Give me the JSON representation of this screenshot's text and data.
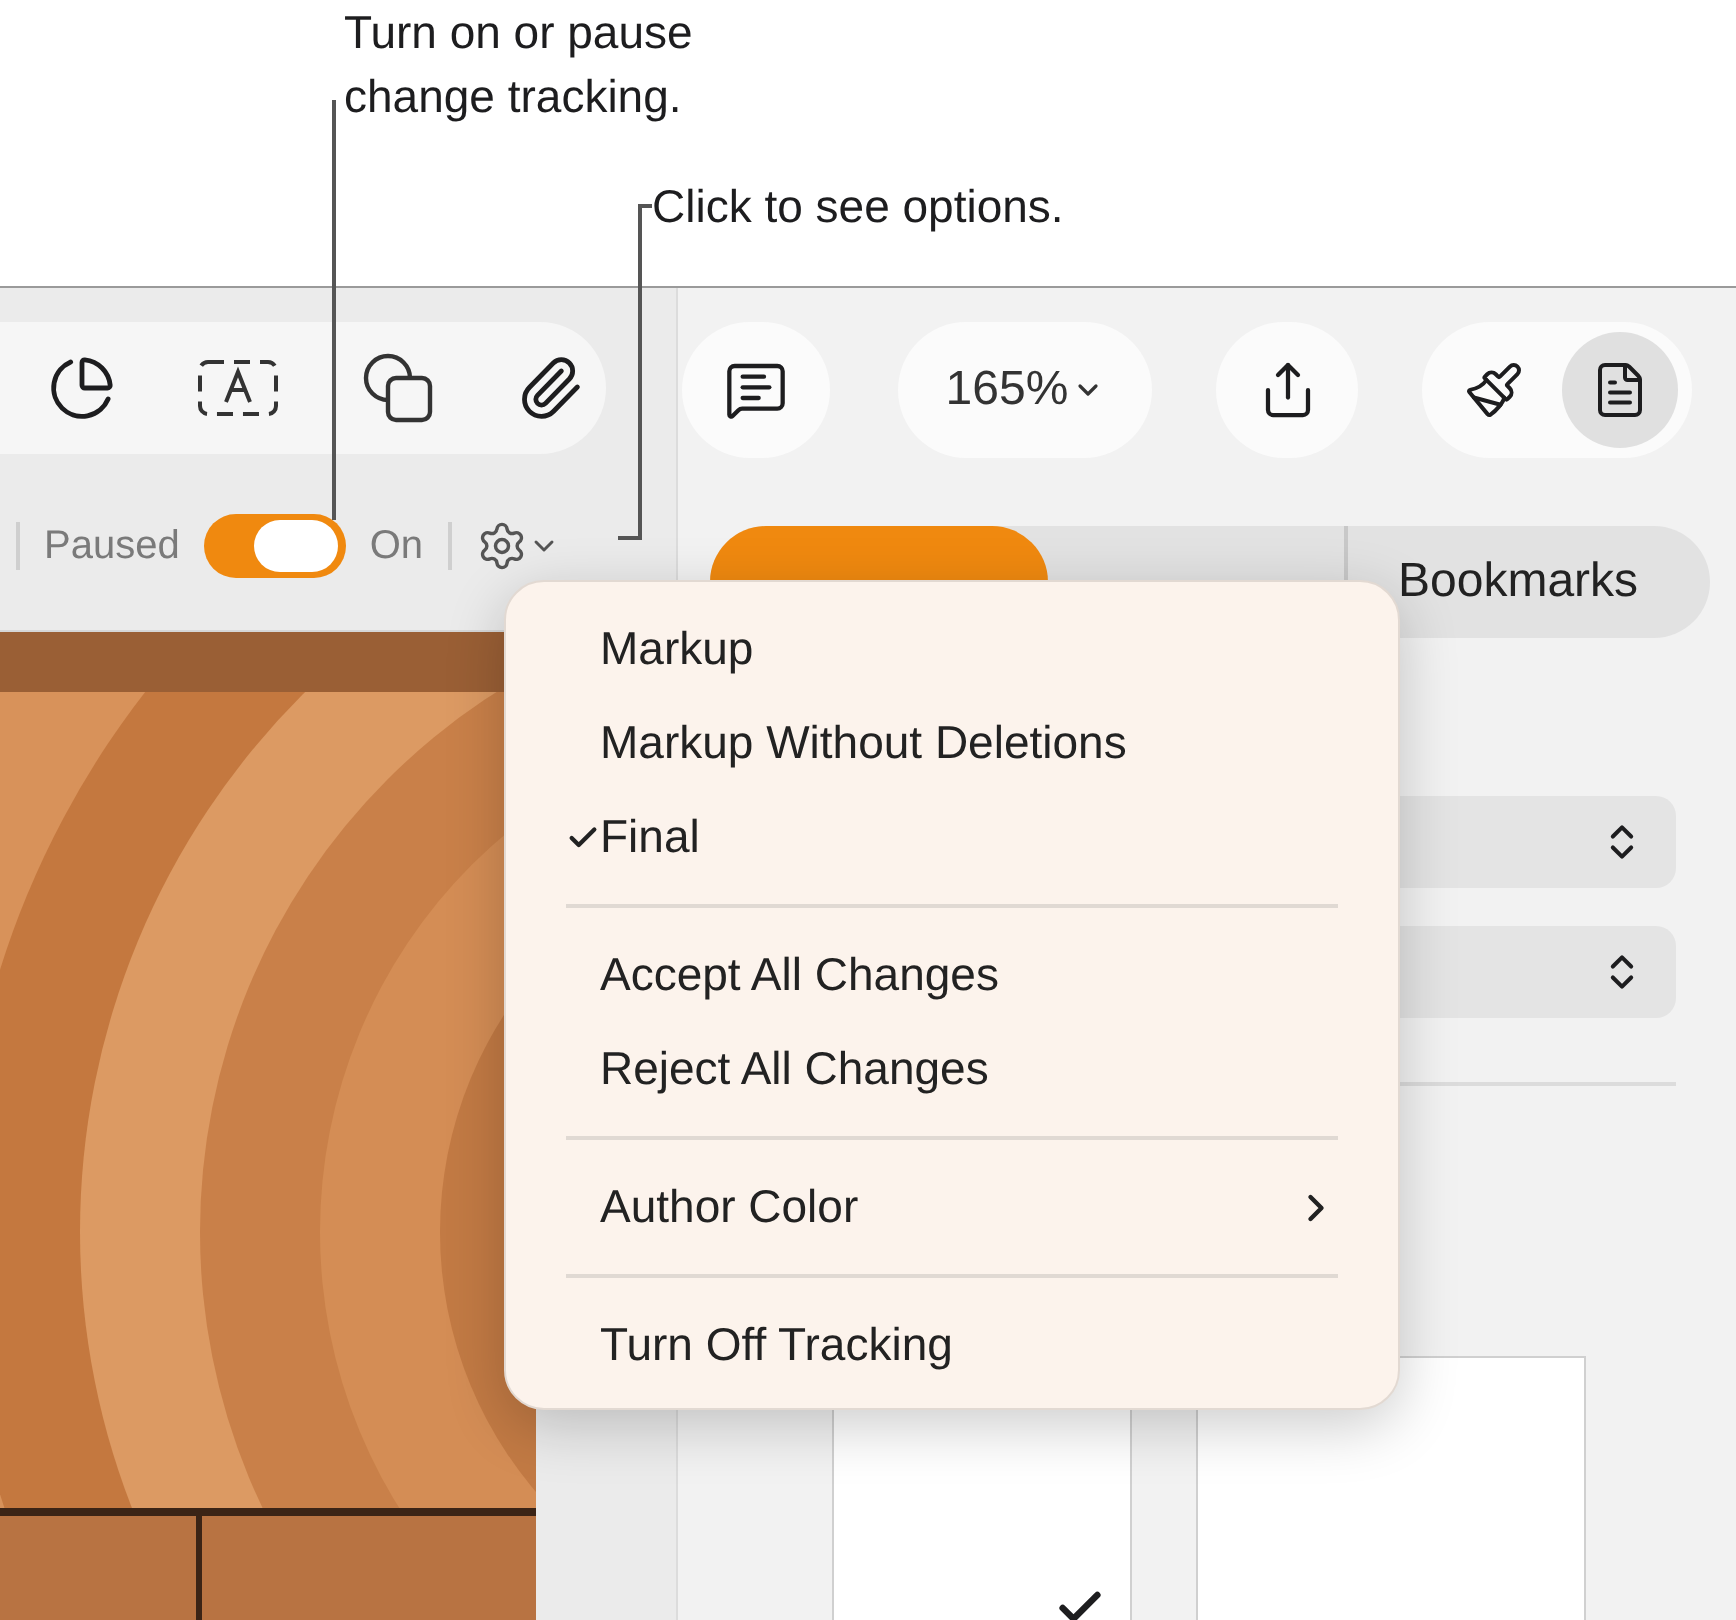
{
  "callouts": [
    {
      "text": "Turn on or pause change tracking."
    },
    {
      "text": "Click to see options."
    }
  ],
  "tracking": {
    "off_label": "Paused",
    "on_label": "On",
    "on": true
  },
  "zoom": {
    "value": "165%"
  },
  "sidebar_buttons": [
    {
      "kind": "brush",
      "selected": false
    },
    {
      "kind": "document",
      "selected": true
    }
  ],
  "tabs": [
    {
      "selected": true
    },
    {
      "selected": false
    },
    {
      "label": "Bookmarks",
      "selected": false
    }
  ],
  "menu": [
    {
      "kind": "item",
      "label": "Markup",
      "checked": false
    },
    {
      "kind": "item",
      "label": "Markup Without Deletions",
      "checked": false
    },
    {
      "kind": "item",
      "label": "Final",
      "checked": true
    },
    {
      "kind": "separator"
    },
    {
      "kind": "item",
      "label": "Accept All Changes",
      "checked": false
    },
    {
      "kind": "item",
      "label": "Reject All Changes",
      "checked": false
    },
    {
      "kind": "separator"
    },
    {
      "kind": "submenu",
      "label": "Author Color",
      "checked": false
    },
    {
      "kind": "separator"
    },
    {
      "kind": "item",
      "label": "Turn Off Tracking",
      "checked": false
    }
  ]
}
